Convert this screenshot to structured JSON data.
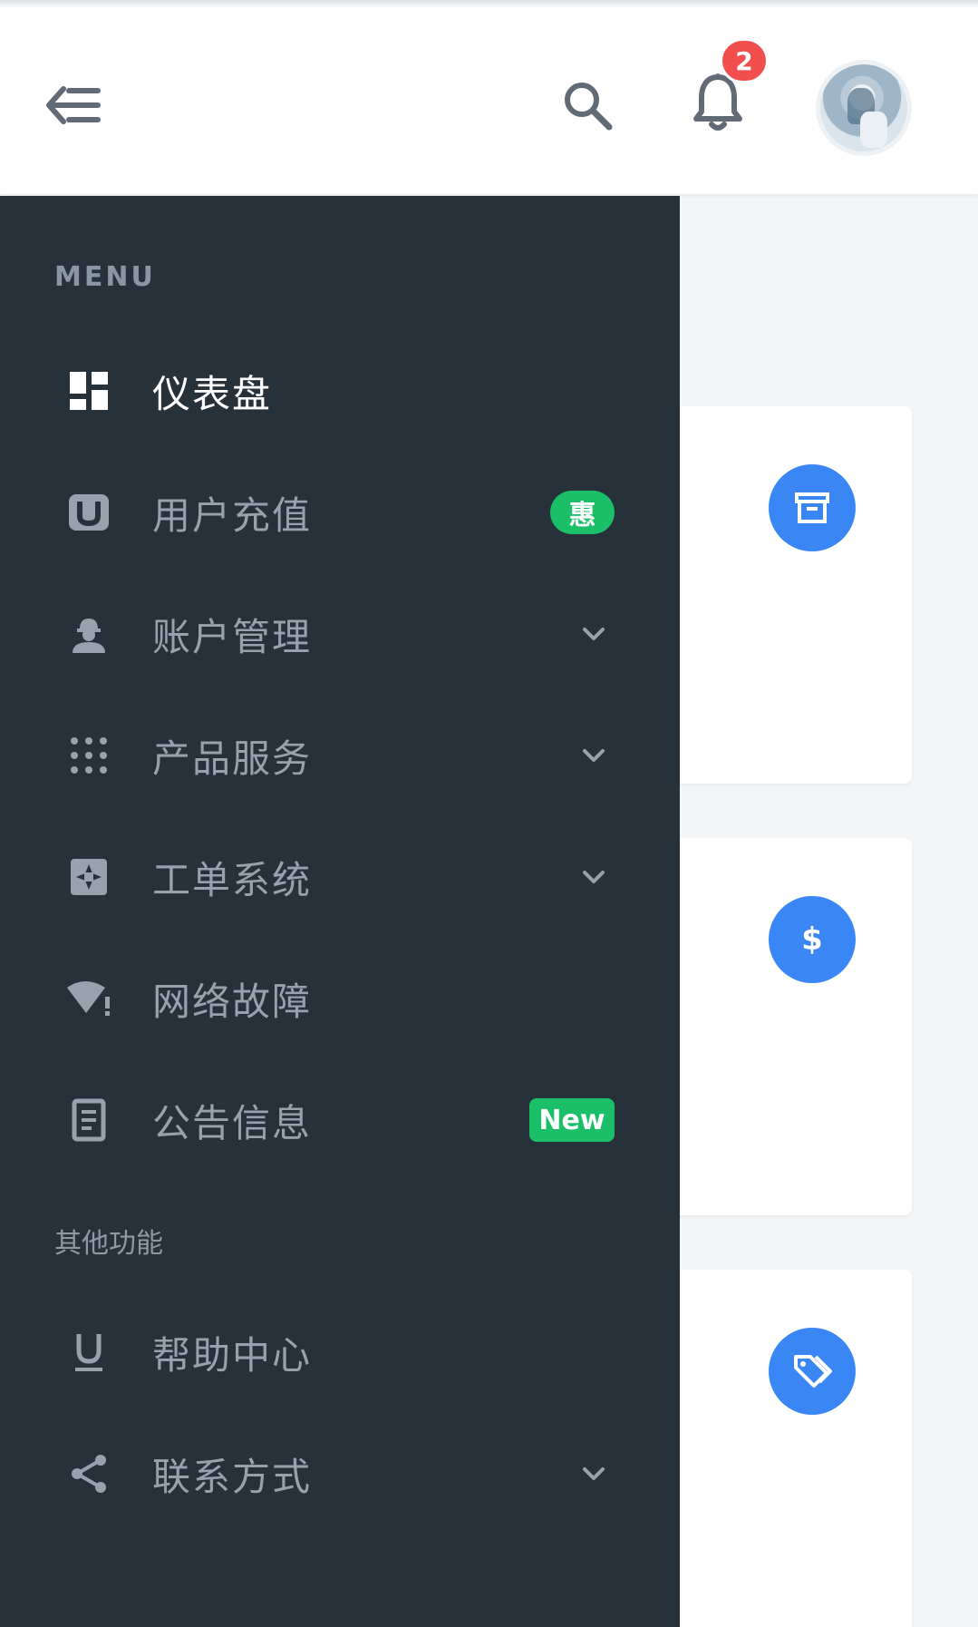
{
  "header": {
    "notification_count": "2"
  },
  "sidebar": {
    "menu_title": "MENU",
    "section_title": "其他功能",
    "items": [
      {
        "label": "仪表盘",
        "icon": "dashboard-icon",
        "active": true
      },
      {
        "label": "用户充值",
        "icon": "u-badge-icon",
        "badge": "惠"
      },
      {
        "label": "账户管理",
        "icon": "worker-icon",
        "expandable": true
      },
      {
        "label": "产品服务",
        "icon": "dots-grid-icon",
        "expandable": true
      },
      {
        "label": "工单系统",
        "icon": "ticket-icon",
        "expandable": true
      },
      {
        "label": "网络故障",
        "icon": "wifi-alert-icon"
      },
      {
        "label": "公告信息",
        "icon": "document-icon",
        "badge": "New"
      }
    ],
    "other_items": [
      {
        "label": "帮助中心",
        "icon": "underline-icon"
      },
      {
        "label": "联系方式",
        "icon": "share-icon",
        "expandable": true
      }
    ]
  },
  "cards": [
    {
      "icon": "archive-icon"
    },
    {
      "icon": "dollar-icon",
      "symbol": "$"
    },
    {
      "icon": "tags-icon"
    }
  ],
  "colors": {
    "sidebar_bg": "#27313a",
    "accent_blue": "#3a86f5",
    "badge_green": "#1bbf68",
    "badge_red": "#f14e4e"
  }
}
